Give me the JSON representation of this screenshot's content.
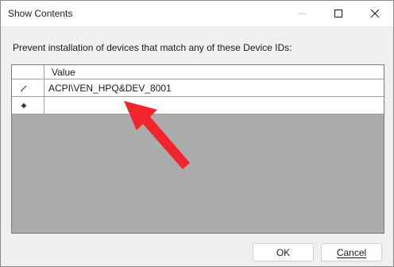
{
  "window": {
    "title": "Show Contents",
    "controls": {
      "minimize": "minimize-icon",
      "maximize": "maximize-icon",
      "close": "close-icon"
    }
  },
  "prompt": "Prevent installation of devices that match any of these Device IDs:",
  "table": {
    "column_header": "Value",
    "rows": [
      {
        "indicator": "edit-pencil-icon",
        "value": "ACPI\\VEN_HPQ&DEV_8001"
      },
      {
        "indicator": "new-row-asterisk-icon",
        "value": ""
      }
    ]
  },
  "buttons": {
    "ok": "OK",
    "cancel": "Cancel"
  },
  "annotation": {
    "shape": "arrow",
    "color": "#f3242b"
  }
}
